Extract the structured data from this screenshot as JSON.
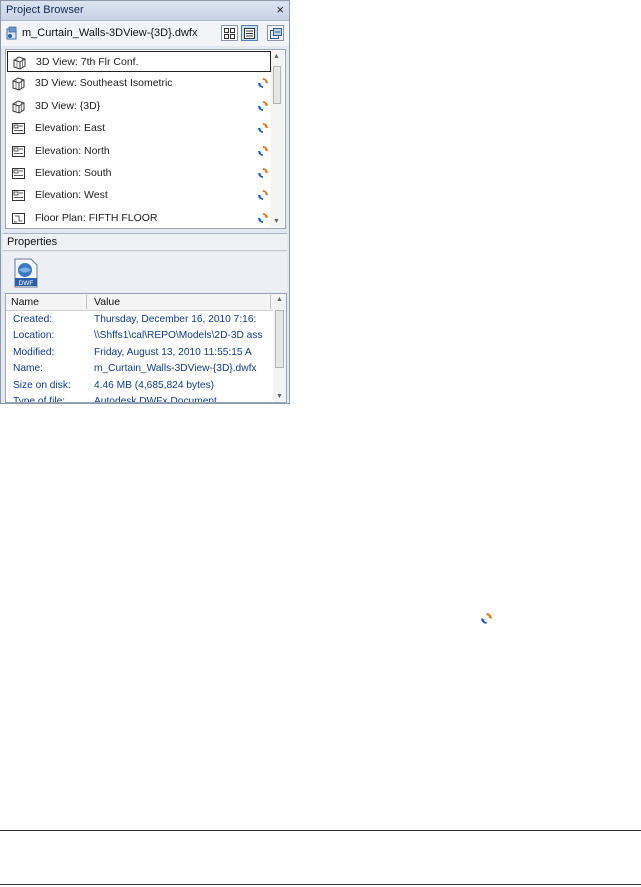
{
  "panel": {
    "title": "Project Browser",
    "close_glyph": "×",
    "file_name": "m_Curtain_Walls-3DView-{3D}.dwfx"
  },
  "tree": {
    "items": [
      {
        "label": "3D View: 7th Flr Conf.",
        "icon": "3d-view-icon",
        "selected": true,
        "sync": false
      },
      {
        "label": "3D View: Southeast Isometric",
        "icon": "3d-view-icon",
        "selected": false,
        "sync": true
      },
      {
        "label": "3D View: {3D}",
        "icon": "3d-view-icon",
        "selected": false,
        "sync": true
      },
      {
        "label": "Elevation: East",
        "icon": "elevation-view-icon",
        "selected": false,
        "sync": true
      },
      {
        "label": "Elevation: North",
        "icon": "elevation-view-icon",
        "selected": false,
        "sync": true
      },
      {
        "label": "Elevation: South",
        "icon": "elevation-view-icon",
        "selected": false,
        "sync": true
      },
      {
        "label": "Elevation: West",
        "icon": "elevation-view-icon",
        "selected": false,
        "sync": true
      },
      {
        "label": "Floor Plan: FIFTH FLOOR",
        "icon": "floor-plan-view-icon",
        "selected": false,
        "sync": true
      }
    ]
  },
  "properties": {
    "header": "Properties",
    "icon_label": "DWF",
    "col_name": "Name",
    "col_value": "Value",
    "rows": [
      {
        "name": "Created:",
        "value": "Thursday, December 16, 2010 7:16:"
      },
      {
        "name": "Location:",
        "value": "\\\\Shffs1\\cal\\REPO\\Models\\2D-3D ass"
      },
      {
        "name": "Modified:",
        "value": "Friday, August 13, 2010 11:55:15 A"
      },
      {
        "name": "Name:",
        "value": "m_Curtain_Walls-3DView-{3D}.dwfx"
      },
      {
        "name": "Size on disk:",
        "value": "4.46 MB (4,685,824 bytes)"
      },
      {
        "name": "Type of file:",
        "value": "Autodesk DWFx Document"
      }
    ]
  },
  "colors": {
    "accent_blue": "#1f5fbf",
    "sync_orange": "#e8731a",
    "value_text": "#123a8c"
  }
}
